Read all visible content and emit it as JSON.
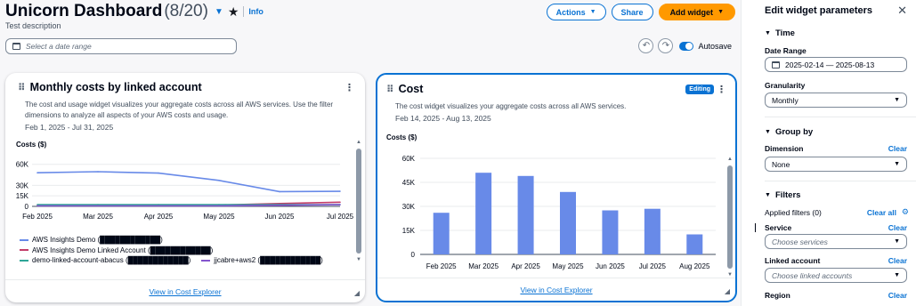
{
  "header": {
    "title": "Unicorn Dashboard",
    "count": "(8/20)",
    "info": "Info",
    "description": "Test description",
    "actions_label": "Actions",
    "share_label": "Share",
    "add_widget_label": "Add widget",
    "date_placeholder": "Select a date range",
    "autosave_label": "Autosave"
  },
  "widget1": {
    "title": "Monthly costs by linked account",
    "description": "The cost and usage widget visualizes your aggregate costs across all AWS services. Use the filter dimensions to analyze all aspects of your AWS costs and usage.",
    "range": "Feb 1, 2025 - Jul 31, 2025",
    "ylabel": "Costs ($)",
    "footer_link": "View in Cost Explorer",
    "legend": [
      {
        "name": "AWS Insights Demo (████████████)",
        "color": "#688ae8"
      },
      {
        "name": "AWS Insights Demo Linked Account (████████████)",
        "color": "#c33d69"
      },
      {
        "name": "demo-linked-account-abacus (████████████)",
        "color": "#2ea597"
      },
      {
        "name": "jjcabre+aws2 (████████████)",
        "color": "#8456ce"
      }
    ]
  },
  "widget2": {
    "title": "Cost",
    "editing_badge": "Editing",
    "description": "The cost widget visualizes your aggregate costs across all AWS services.",
    "range": "Feb 14, 2025 - Aug 13, 2025",
    "ylabel": "Costs ($)",
    "footer_link": "View in Cost Explorer"
  },
  "chart_data": [
    {
      "type": "line",
      "title": "Monthly costs by linked account",
      "ylabel": "Costs ($)",
      "x": [
        "Feb 2025",
        "Mar 2025",
        "Apr 2025",
        "May 2025",
        "Jun 2025",
        "Jul 2025"
      ],
      "yticks": [
        0,
        15000,
        30000,
        60000
      ],
      "ytick_labels": [
        "0",
        "15K",
        "30K",
        "60K"
      ],
      "ylim": [
        0,
        66000
      ],
      "series": [
        {
          "name": "AWS Insights Demo (████████████)",
          "color": "#688ae8",
          "values": [
            48000,
            49500,
            47500,
            37000,
            21000,
            21500
          ]
        },
        {
          "name": "AWS Insights Demo Linked Account (████████████)",
          "color": "#c33d69",
          "values": [
            1500,
            1500,
            1500,
            2000,
            4000,
            6000
          ]
        },
        {
          "name": "demo-linked-account-abacus (████████████)",
          "color": "#2ea597",
          "values": [
            2500,
            2500,
            2500,
            2500,
            2500,
            2500
          ]
        },
        {
          "name": "jjcabre+aws2 (████████████)",
          "color": "#8456ce",
          "values": [
            800,
            800,
            800,
            800,
            1500,
            2500
          ]
        }
      ],
      "grid": true,
      "legend": "bottom"
    },
    {
      "type": "bar",
      "title": "Cost",
      "ylabel": "Costs ($)",
      "categories": [
        "Feb 2025",
        "Mar 2025",
        "Apr 2025",
        "May 2025",
        "Jun 2025",
        "Jul 2025",
        "Aug 2025"
      ],
      "values": [
        26000,
        51000,
        49000,
        39000,
        27500,
        28500,
        12500
      ],
      "yticks": [
        0,
        15000,
        30000,
        45000,
        60000
      ],
      "ytick_labels": [
        "0",
        "15K",
        "30K",
        "45K",
        "60K"
      ],
      "ylim": [
        0,
        60000
      ],
      "color": "#688ae8",
      "grid": true
    }
  ],
  "panel": {
    "title": "Edit widget parameters",
    "time_section": "Time",
    "date_range_label": "Date Range",
    "date_range_value": "2025-02-14 — 2025-08-13",
    "granularity_label": "Granularity",
    "granularity_value": "Monthly",
    "group_section": "Group by",
    "dimension_label": "Dimension",
    "dimension_value": "None",
    "clear_label": "Clear",
    "filters_section": "Filters",
    "applied_filters": "Applied filters (0)",
    "clear_all_label": "Clear all",
    "service_label": "Service",
    "service_placeholder": "Choose services",
    "linked_account_label": "Linked account",
    "linked_account_placeholder": "Choose linked accounts",
    "region_label": "Region"
  }
}
